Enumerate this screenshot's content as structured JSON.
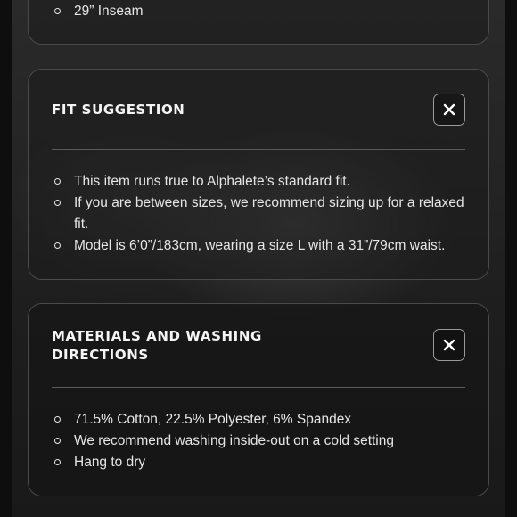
{
  "top_card": {
    "items": [
      "29” Inseam"
    ]
  },
  "fit_suggestion": {
    "title": "FIT SUGGESTION",
    "close_icon": "close-icon",
    "items": [
      "This item runs true to Alphalete’s standard fit.",
      "If you are between sizes, we recommend sizing up for a relaxed fit.",
      "Model is 6’0”/183cm, wearing a size L with a 31”/79cm waist."
    ]
  },
  "materials": {
    "title_line1": "MATERIALS AND WASHING",
    "title_line2": "DIRECTIONS",
    "close_icon": "close-icon",
    "items": [
      "71.5% Cotton, 22.5% Polyester, 6% Spandex",
      "We recommend washing inside-out on a cold setting",
      "Hang to dry"
    ]
  }
}
